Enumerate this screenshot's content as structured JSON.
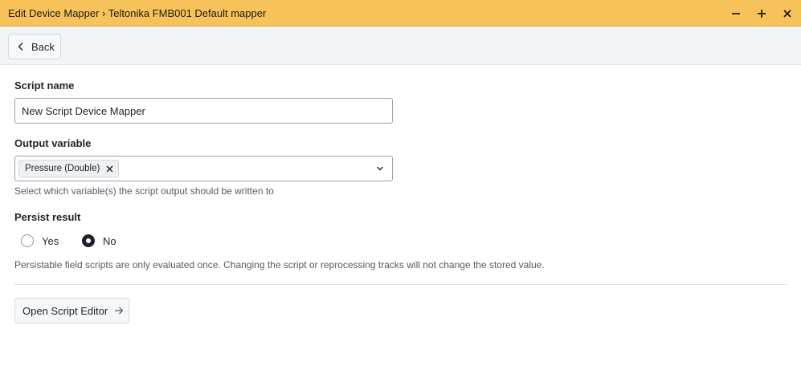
{
  "window": {
    "title": "Edit Device Mapper › Teltonika FMB001 Default mapper",
    "controls": {
      "minimize": "minimize-icon",
      "maximize": "plus-icon",
      "close": "close-icon"
    }
  },
  "toolbar": {
    "back_label": "Back",
    "back_icon": "chevron-left-icon"
  },
  "form": {
    "script_name": {
      "label": "Script name",
      "value": "New Script Device Mapper"
    },
    "output_variable": {
      "label": "Output variable",
      "selected": [
        "Pressure (Double)"
      ],
      "help": "Select which variable(s) the script output should be written to"
    },
    "persist_result": {
      "label": "Persist result",
      "options": [
        {
          "label": "Yes",
          "checked": false
        },
        {
          "label": "No",
          "checked": true
        }
      ],
      "help": "Persistable field scripts are only evaluated once. Changing the script or reprocessing tracks will not change the stored value."
    },
    "open_editor_label": "Open Script Editor",
    "open_editor_icon": "arrow-right-icon"
  },
  "colors": {
    "titlebar": "#f7c25a",
    "toolbar": "#f3f4f6",
    "text": "#1f2329",
    "help_text": "#555b63"
  }
}
